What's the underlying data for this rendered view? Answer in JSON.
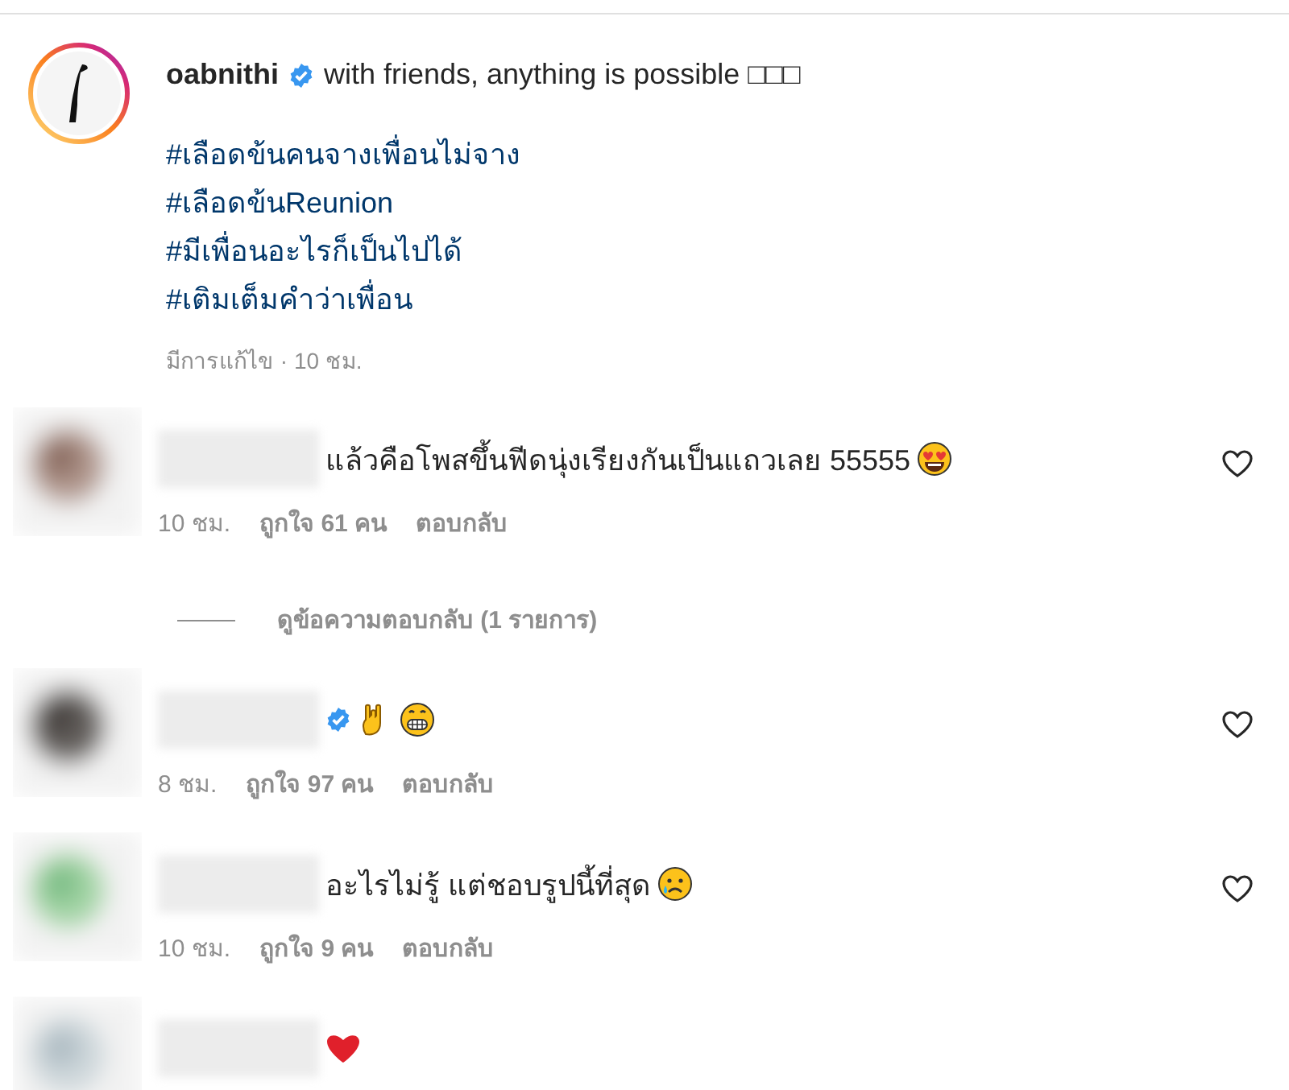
{
  "post": {
    "username": "oabnithi",
    "verified": true,
    "caption": "with friends, anything is possible □□□",
    "hashtags": [
      "#เลือดข้นคนจางเพื่อนไม่จาง",
      "#เลือดข้นReunion",
      "#มีเพื่อนอะไรก็เป็นไปได้",
      "#เติมเต็มคำว่าเพื่อน"
    ],
    "meta": "มีการแก้ไข · 10 ชม."
  },
  "comments": [
    {
      "verified": false,
      "text": "แล้วคือโพสขึ้นฟีดนุ่งเรียงกันเป็นแถวเลย 55555",
      "icons": [
        {
          "kind": "heart-eyes"
        }
      ],
      "time": "10 ชม.",
      "likes": "ถูกใจ 61 คน",
      "reply": "ตอบกลับ",
      "liked": false,
      "view_replies": "ดูข้อความตอบกลับ (1 รายการ)"
    },
    {
      "verified": true,
      "icons": [
        {
          "kind": "horns-hand"
        },
        {
          "kind": "grin"
        }
      ],
      "time": "8 ชม.",
      "likes": "ถูกใจ 97 คน",
      "reply": "ตอบกลับ",
      "liked": false
    },
    {
      "verified": false,
      "text": "อะไรไม่รู้ แต่ชอบรูปนี้ที่สุด",
      "icons": [
        {
          "kind": "sad-tear"
        }
      ],
      "time": "10 ชม.",
      "likes": "ถูกใจ 9 คน",
      "reply": "ตอบกลับ",
      "liked": false
    },
    {
      "verified": false,
      "icons": [
        {
          "kind": "red-heart"
        }
      ]
    }
  ]
}
